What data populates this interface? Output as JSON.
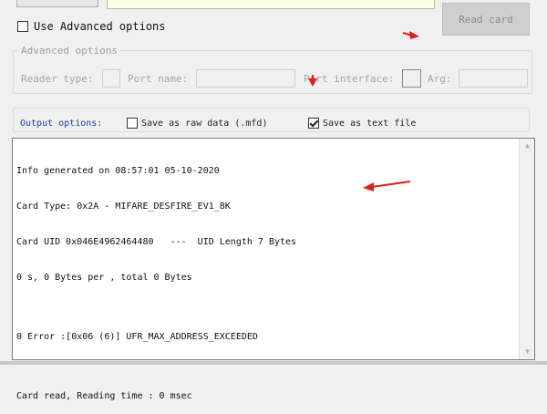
{
  "read_card_label": "Read card",
  "use_advanced_label": "Use Advanced options",
  "advanced_group": {
    "title": "Advanced options",
    "reader_type_label": "Reader type:",
    "port_name_label": "Port name:",
    "port_interface_label": "Port interface:",
    "arg_label": "Arg:"
  },
  "output_options": {
    "label": "Output options:",
    "raw_label": "Save as raw data (.mfd)",
    "raw_checked": false,
    "text_label": "Save as text file",
    "text_checked": true
  },
  "output_lines": [
    "Info generated on 08:57:01 05-10-2020",
    "Card Type: 0x2A - MIFARE_DESFIRE_EV1_8K",
    "Card UID 0x046E4962464480   ---  UID Length 7 Bytes",
    "0 s, 0 Bytes per , total 0 Bytes",
    "",
    "0 Error :[0x06 (6)] UFR_MAX_ADDRESS_EXCEEDED",
    "",
    "Card read, Reading time : 0 msec"
  ],
  "icons": {
    "scroll_up": "▲",
    "scroll_down": "▼"
  },
  "colors": {
    "annotation_arrow": "#e0201a",
    "output_label": "#1a3fa0",
    "yellow_field": "#ffffe1"
  }
}
